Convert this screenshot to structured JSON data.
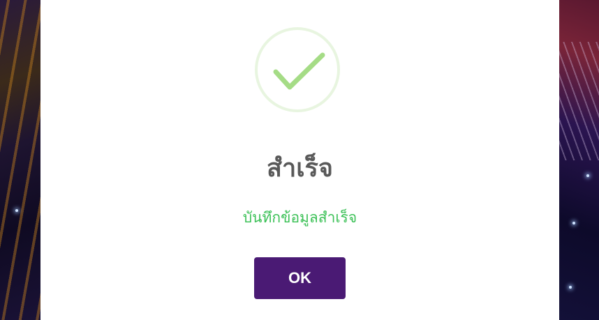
{
  "dialog": {
    "icon": "check-circle-icon",
    "title": "สำเร็จ",
    "message": "บันทึกข้อมูลสำเร็จ",
    "ok_label": "OK"
  },
  "colors": {
    "button": "#4a1a74",
    "message": "#3cc157",
    "title": "#595959",
    "check": "#a5dc86",
    "check_ring": "#e8f5e0"
  }
}
